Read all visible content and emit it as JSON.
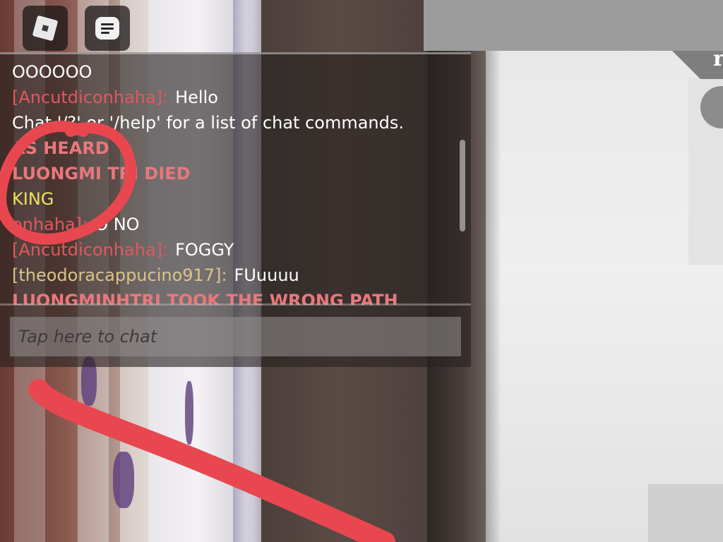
{
  "chat": {
    "messages": [
      {
        "speaker": "",
        "text": "OOOOOO",
        "speaker_color": "#ffffff",
        "style": "plain"
      },
      {
        "speaker": "[Ancutdiconhaha]:",
        "text": "Hello",
        "speaker_color": "#e2585e",
        "style": "plain"
      },
      {
        "speaker": "",
        "text": "Chat '/?' or '/help' for a list of chat commands.",
        "speaker_color": "#ffffff",
        "style": "plain"
      },
      {
        "speaker": "",
        "text": "AS HEARD",
        "speaker_color": "#e8787c",
        "style": "system-red"
      },
      {
        "speaker": "",
        "text": "LUONGMI TRI DIED",
        "speaker_color": "#e8787c",
        "style": "system-red"
      },
      {
        "speaker": "",
        "text": "KING",
        "speaker_color": "#f0e05f",
        "style": "system-gold"
      },
      {
        "speaker": "onhaha]:",
        "text": "O NO",
        "speaker_color": "#e2585e",
        "style": "plain"
      },
      {
        "speaker": "[Ancutdiconhaha]:",
        "text": "FOGGY",
        "speaker_color": "#e2585e",
        "style": "plain"
      },
      {
        "speaker": "[theodoracappucino917]:",
        "text": "FUuuuu",
        "speaker_color": "#d9c48a",
        "style": "plain"
      },
      {
        "speaker": "",
        "text": "LUONGMINHTRI TOOK THE WRONG PATH",
        "speaker_color": "#e8787c",
        "style": "system-red"
      }
    ],
    "input_placeholder": "Tap here to chat"
  },
  "topbar": {
    "roblox_icon": "roblox-logo-icon",
    "chat_icon": "chat-icon"
  },
  "hud": {
    "right_letter": "r"
  },
  "colors": {
    "annotation": "#e8474f",
    "system_red": "#e8787c",
    "system_gold": "#f0e05f",
    "player_red": "#e2585e",
    "player_tan": "#d9c48a"
  }
}
